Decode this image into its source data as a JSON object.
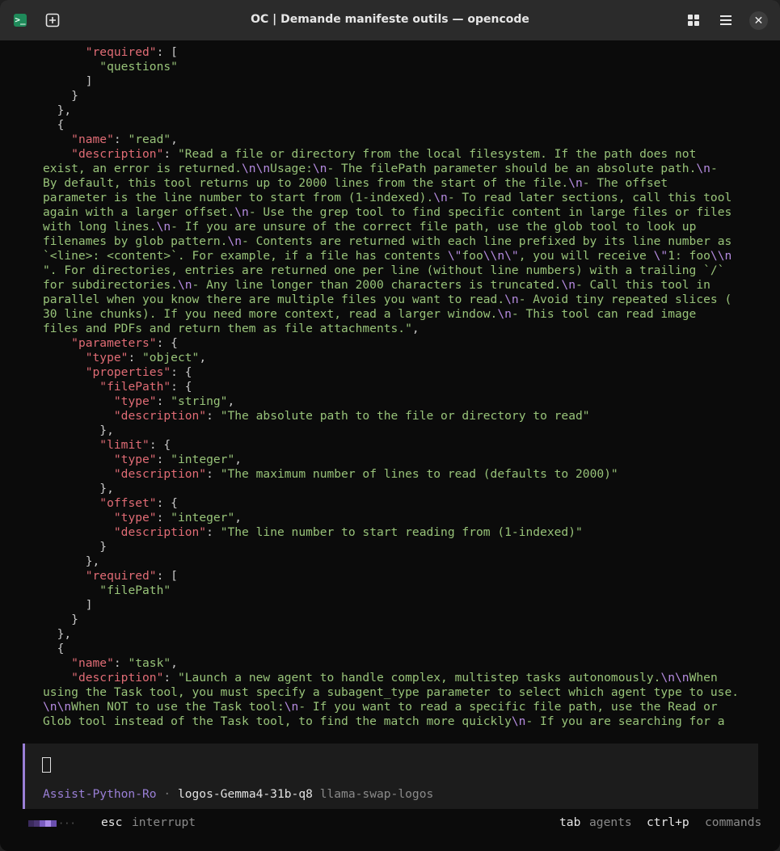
{
  "window": {
    "title": "OC | Demande manifeste outils — opencode",
    "icons": [
      "terminal-icon",
      "new-tab-icon",
      "grid-icon",
      "menu-icon",
      "close-icon"
    ]
  },
  "terminal": {
    "code_lines": [
      [
        [
          "",
          "      "
        ],
        [
          "k",
          "\"required\""
        ],
        [
          "",
          ": ["
        ]
      ],
      [
        [
          "",
          "        "
        ],
        [
          "s",
          "\"questions\""
        ]
      ],
      [
        [
          "",
          "      ]"
        ]
      ],
      [
        [
          "",
          "    }"
        ]
      ],
      [
        [
          "",
          "  },"
        ]
      ],
      [
        [
          "",
          "  {"
        ]
      ],
      [
        [
          "",
          "    "
        ],
        [
          "k",
          "\"name\""
        ],
        [
          "",
          ": "
        ],
        [
          "s",
          "\"read\""
        ],
        [
          "",
          ","
        ]
      ],
      [
        [
          "",
          "    "
        ],
        [
          "k",
          "\"description\""
        ],
        [
          "",
          ": "
        ],
        [
          "s",
          "\"Read a file or directory from the local filesystem. If the path does not"
        ]
      ],
      [
        [
          "s",
          "exist, an error is returned."
        ],
        [
          "e",
          "\\n\\n"
        ],
        [
          "s",
          "Usage:"
        ],
        [
          "e",
          "\\n"
        ],
        [
          "s",
          "- The filePath parameter should be an absolute path."
        ],
        [
          "e",
          "\\n"
        ],
        [
          "s",
          "-"
        ]
      ],
      [
        [
          "s",
          "By default, this tool returns up to 2000 lines from the start of the file."
        ],
        [
          "e",
          "\\n"
        ],
        [
          "s",
          "- The offset"
        ]
      ],
      [
        [
          "s",
          "parameter is the line number to start from (1-indexed)."
        ],
        [
          "e",
          "\\n"
        ],
        [
          "s",
          "- To read later sections, call this tool"
        ]
      ],
      [
        [
          "s",
          "again with a larger offset."
        ],
        [
          "e",
          "\\n"
        ],
        [
          "s",
          "- Use the grep tool to find specific content in large files or files"
        ]
      ],
      [
        [
          "s",
          "with long lines."
        ],
        [
          "e",
          "\\n"
        ],
        [
          "s",
          "- If you are unsure of the correct file path, use the glob tool to look up"
        ]
      ],
      [
        [
          "s",
          "filenames by glob pattern."
        ],
        [
          "e",
          "\\n"
        ],
        [
          "s",
          "- Contents are returned with each line prefixed by its line number as"
        ]
      ],
      [
        [
          "s",
          "`<line>: <content>`. For example, if a file has contents "
        ],
        [
          "e",
          "\\\""
        ],
        [
          "s",
          "foo"
        ],
        [
          "e",
          "\\\\n\\\""
        ],
        [
          "s",
          ", you will receive "
        ],
        [
          "e",
          "\\\""
        ],
        [
          "s",
          "1: foo"
        ],
        [
          "e",
          "\\\\n"
        ]
      ],
      [
        [
          "s",
          "\". For directories, entries are returned one per line (without line numbers) with a trailing `/`"
        ]
      ],
      [
        [
          "s",
          "for subdirectories."
        ],
        [
          "e",
          "\\n"
        ],
        [
          "s",
          "- Any line longer than 2000 characters is truncated."
        ],
        [
          "e",
          "\\n"
        ],
        [
          "s",
          "- Call this tool in"
        ]
      ],
      [
        [
          "s",
          "parallel when you know there are multiple files you want to read."
        ],
        [
          "e",
          "\\n"
        ],
        [
          "s",
          "- Avoid tiny repeated slices ("
        ]
      ],
      [
        [
          "s",
          "30 line chunks). If you need more context, read a larger window."
        ],
        [
          "e",
          "\\n"
        ],
        [
          "s",
          "- This tool can read image"
        ]
      ],
      [
        [
          "s",
          "files and PDFs and return them as file attachments.\""
        ],
        [
          "",
          ","
        ]
      ],
      [
        [
          "",
          "    "
        ],
        [
          "k",
          "\"parameters\""
        ],
        [
          "",
          ": {"
        ]
      ],
      [
        [
          "",
          "      "
        ],
        [
          "k",
          "\"type\""
        ],
        [
          "",
          ": "
        ],
        [
          "s",
          "\"object\""
        ],
        [
          "",
          ","
        ]
      ],
      [
        [
          "",
          "      "
        ],
        [
          "k",
          "\"properties\""
        ],
        [
          "",
          ": {"
        ]
      ],
      [
        [
          "",
          "        "
        ],
        [
          "k",
          "\"filePath\""
        ],
        [
          "",
          ": {"
        ]
      ],
      [
        [
          "",
          "          "
        ],
        [
          "k",
          "\"type\""
        ],
        [
          "",
          ": "
        ],
        [
          "s",
          "\"string\""
        ],
        [
          "",
          ","
        ]
      ],
      [
        [
          "",
          "          "
        ],
        [
          "k",
          "\"description\""
        ],
        [
          "",
          ": "
        ],
        [
          "s",
          "\"The absolute path to the file or directory to read\""
        ]
      ],
      [
        [
          "",
          "        },"
        ]
      ],
      [
        [
          "",
          "        "
        ],
        [
          "k",
          "\"limit\""
        ],
        [
          "",
          ": {"
        ]
      ],
      [
        [
          "",
          "          "
        ],
        [
          "k",
          "\"type\""
        ],
        [
          "",
          ": "
        ],
        [
          "s",
          "\"integer\""
        ],
        [
          "",
          ","
        ]
      ],
      [
        [
          "",
          "          "
        ],
        [
          "k",
          "\"description\""
        ],
        [
          "",
          ": "
        ],
        [
          "s",
          "\"The maximum number of lines to read (defaults to 2000)\""
        ]
      ],
      [
        [
          "",
          "        },"
        ]
      ],
      [
        [
          "",
          "        "
        ],
        [
          "k",
          "\"offset\""
        ],
        [
          "",
          ": {"
        ]
      ],
      [
        [
          "",
          "          "
        ],
        [
          "k",
          "\"type\""
        ],
        [
          "",
          ": "
        ],
        [
          "s",
          "\"integer\""
        ],
        [
          "",
          ","
        ]
      ],
      [
        [
          "",
          "          "
        ],
        [
          "k",
          "\"description\""
        ],
        [
          "",
          ": "
        ],
        [
          "s",
          "\"The line number to start reading from (1-indexed)\""
        ]
      ],
      [
        [
          "",
          "        }"
        ]
      ],
      [
        [
          "",
          "      },"
        ]
      ],
      [
        [
          "",
          "      "
        ],
        [
          "k",
          "\"required\""
        ],
        [
          "",
          ": ["
        ]
      ],
      [
        [
          "",
          "        "
        ],
        [
          "s",
          "\"filePath\""
        ]
      ],
      [
        [
          "",
          "      ]"
        ]
      ],
      [
        [
          "",
          "    }"
        ]
      ],
      [
        [
          "",
          "  },"
        ]
      ],
      [
        [
          "",
          "  {"
        ]
      ],
      [
        [
          "",
          "    "
        ],
        [
          "k",
          "\"name\""
        ],
        [
          "",
          ": "
        ],
        [
          "s",
          "\"task\""
        ],
        [
          "",
          ","
        ]
      ],
      [
        [
          "",
          "    "
        ],
        [
          "k",
          "\"description\""
        ],
        [
          "",
          ": "
        ],
        [
          "s",
          "\"Launch a new agent to handle complex, multistep tasks autonomously."
        ],
        [
          "e",
          "\\n\\n"
        ],
        [
          "s",
          "When"
        ]
      ],
      [
        [
          "s",
          "using the Task tool, you must specify a subagent_type parameter to select which agent type to use."
        ]
      ],
      [
        [
          "e",
          "\\n\\n"
        ],
        [
          "s",
          "When NOT to use the Task tool:"
        ],
        [
          "e",
          "\\n"
        ],
        [
          "s",
          "- If you want to read a specific file path, use the Read or"
        ]
      ],
      [
        [
          "s",
          "Glob tool instead of the Task tool, to find the match more quickly"
        ],
        [
          "e",
          "\\n"
        ],
        [
          "s",
          "- If you are searching for a"
        ]
      ]
    ]
  },
  "prompt": {
    "input_value": "",
    "agent": "Assist-Python-Ro",
    "separator": " · ",
    "model": "logos-Gemma4-31b-q8",
    "provider": "llama-swap-logos"
  },
  "statusbar": {
    "spinner_colors": [
      "#3a2a5c",
      "#4a3673",
      "#7a5cc0",
      "#a98ae8",
      "#6a4fae"
    ],
    "spinner_dots": "···",
    "esc_key": "esc",
    "esc_label": "interrupt",
    "tab_key": "tab",
    "tab_label": "agents",
    "ctrl_key": "ctrl+p",
    "ctrl_label": "commands"
  },
  "colors": {
    "key": "#e06c75",
    "string": "#98c379",
    "escape": "#b58be0",
    "accent": "#9a7fd6"
  }
}
